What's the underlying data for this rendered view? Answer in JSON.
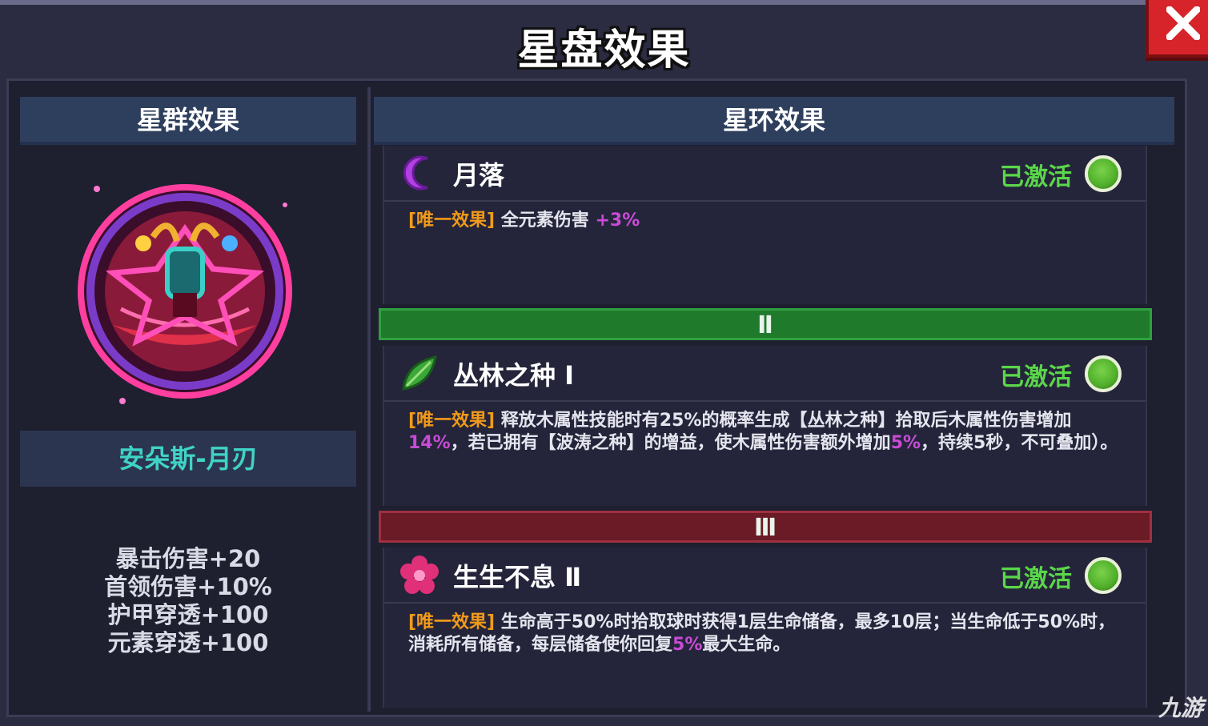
{
  "window": {
    "title": "星盘效果"
  },
  "left": {
    "header": "星群效果",
    "constellation_name": "安朵斯-月刃",
    "stats": [
      "暴击伤害+20",
      "首领伤害+10%",
      "护甲穿透+100",
      "元素穿透+100"
    ]
  },
  "right": {
    "header": "星环效果",
    "effects": [
      {
        "name": "月落",
        "icon": "crescent-moon-icon",
        "status": "已激活",
        "tag": "[唯一效果]",
        "desc_parts": [
          "全元素伤害 ",
          "+3%"
        ]
      },
      {
        "tier": "Ⅱ",
        "name": "丛林之种 Ⅰ",
        "icon": "green-leaf-icon",
        "status": "已激活",
        "tag": "[唯一效果]",
        "desc_parts": [
          "释放木属性技能时有25%的概率生成【丛林之种】拾取后木属性伤害增加",
          "14%",
          "，若已拥有【波涛之种】的增益，使木属性伤害额外增加",
          "5%",
          "，持续5秒，不可叠加）。"
        ]
      },
      {
        "tier": "Ⅲ",
        "name": "生生不息 Ⅱ",
        "icon": "pink-flower-icon",
        "status": "已激活",
        "tag": "[唯一效果]",
        "desc_parts": [
          "生命高于50%时拾取球时获得1层生命储备，最多10层；当生命低于50%时，消耗所有储备，每层储备使你回复",
          "5%",
          "最大生命。"
        ]
      }
    ]
  },
  "watermark": "九游",
  "colors": {
    "accent_green": "#5bd64a",
    "tag_orange": "#f29a1a",
    "highlight_purple": "#c84bd6",
    "name_teal": "#3fd3c6"
  }
}
